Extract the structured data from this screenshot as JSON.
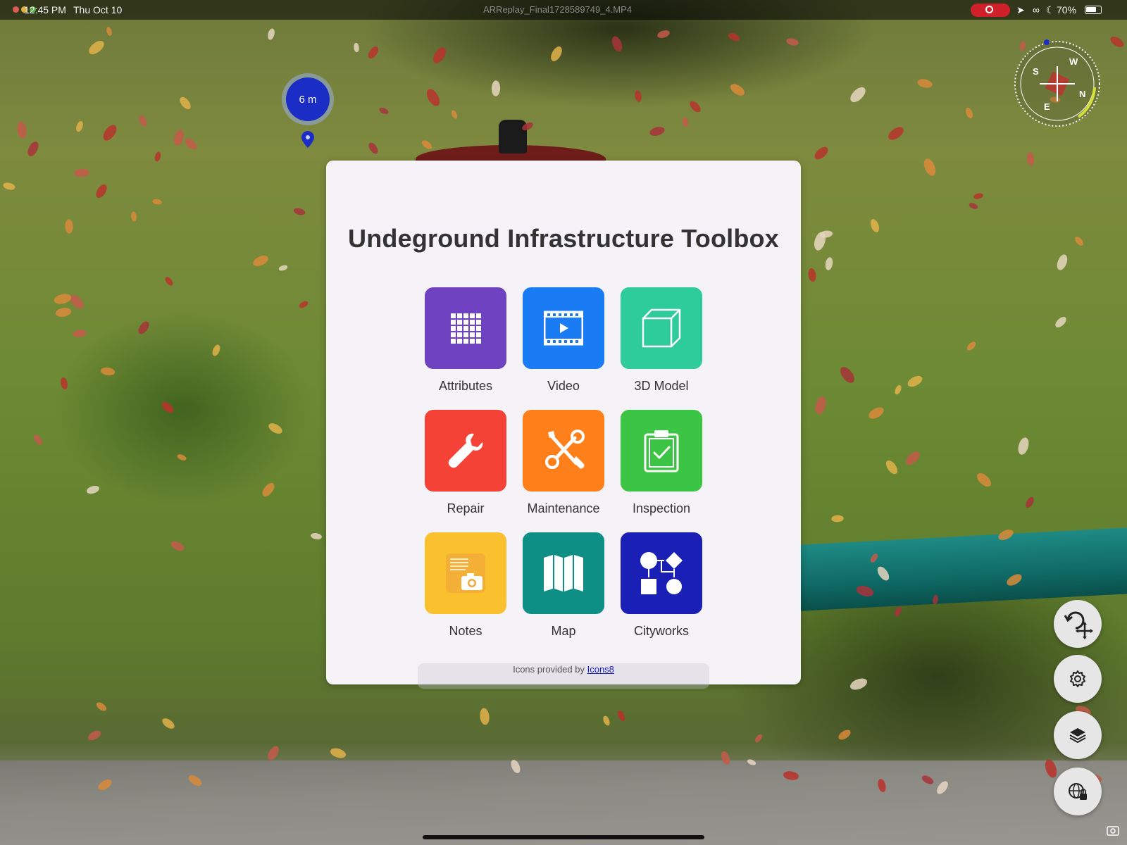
{
  "status_bar": {
    "time": "12:45 PM",
    "date": "Thu Oct 10",
    "window_title": "ARReplay_Final1728589749_4.MP4",
    "battery": "70%"
  },
  "marker": {
    "distance": "6 m"
  },
  "compass": {
    "labels": [
      "W",
      "N",
      "E",
      "S"
    ]
  },
  "toolbox": {
    "title": "Undeground Infrastructure Toolbox",
    "tiles": [
      {
        "label": "Attributes",
        "color": "#6f42c1",
        "icon": "table-icon"
      },
      {
        "label": "Video",
        "color": "#1a7cf5",
        "icon": "video-icon"
      },
      {
        "label": "3D Model",
        "color": "#2ecc9a",
        "icon": "cube-icon"
      },
      {
        "label": "Repair",
        "color": "#f44336",
        "icon": "wrench-icon"
      },
      {
        "label": "Maintenance",
        "color": "#ff7f1a",
        "icon": "tools-icon"
      },
      {
        "label": "Inspection",
        "color": "#3cc544",
        "icon": "clipboard-check-icon"
      },
      {
        "label": "Notes",
        "color": "#fbc02d",
        "icon": "notes-camera-icon"
      },
      {
        "label": "Map",
        "color": "#0e8f86",
        "icon": "map-icon"
      },
      {
        "label": "Cityworks",
        "color": "#1a1fb5",
        "icon": "workflow-icon"
      }
    ],
    "credit_prefix": "Icons provided by",
    "credit_link": "Icons8"
  },
  "fabs": [
    {
      "icon": "rotate-move-icon"
    },
    {
      "icon": "gear-icon"
    },
    {
      "icon": "layers-icon"
    },
    {
      "icon": "globe-lock-icon"
    }
  ]
}
